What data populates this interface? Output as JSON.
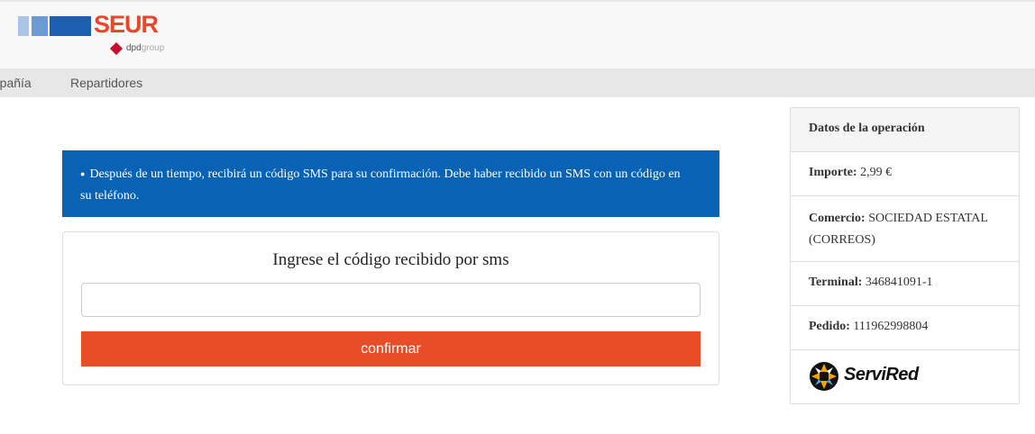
{
  "header": {
    "brand": "SEUR",
    "dpd_text": "dpd",
    "group_text": "group",
    "logo_colors": [
      "#a9c4e6",
      "#6a9bd4",
      "#1c5fb0",
      "#e8472a"
    ]
  },
  "nav": {
    "items": [
      "mpañía",
      "Repartidores"
    ]
  },
  "alert": {
    "icon": "info-icon",
    "text": "Después de un tiempo, recibirá un código SMS para su confirmación. Debe haber recibido un SMS con un código en su teléfono."
  },
  "form": {
    "title": "Ingrese el código recibido por sms",
    "code_value": "",
    "code_placeholder": "",
    "confirm_label": "confirmar",
    "confirm_color": "#e84d27"
  },
  "operation": {
    "title": "Datos de la operación",
    "importe_label": "Importe:",
    "importe_value": "2,99 €",
    "comercio_label": "Comercio:",
    "comercio_value": "SOCIEDAD ESTATAL (CORREOS)",
    "terminal_label": "Terminal:",
    "terminal_value": "346841091-1",
    "pedido_label": "Pedido:",
    "pedido_value": "111962998804",
    "logo_text": "ServiRed"
  }
}
